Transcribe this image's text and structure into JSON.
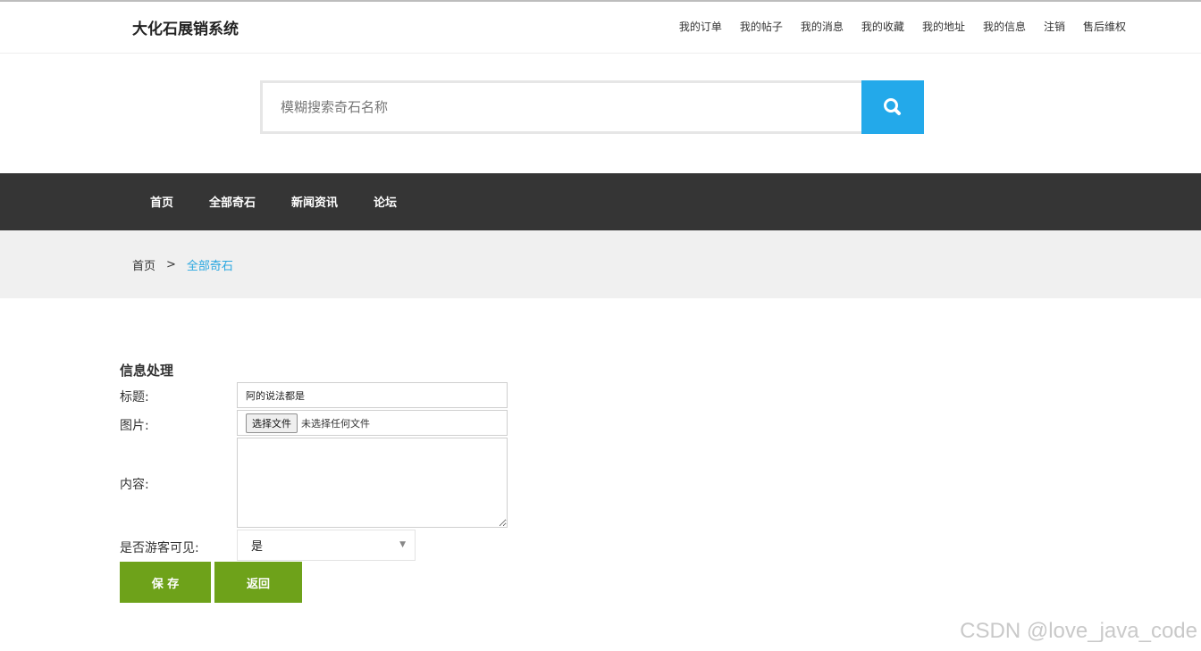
{
  "header": {
    "site_title": "大化石展销系统",
    "top_nav": [
      "我的订单",
      "我的帖子",
      "我的消息",
      "我的收藏",
      "我的地址",
      "我的信息",
      "注销",
      "售后维权"
    ]
  },
  "search": {
    "placeholder": "模糊搜索奇石名称",
    "button_icon": "search-icon",
    "accent_color": "#23a9ea"
  },
  "main_nav": {
    "items": [
      "首页",
      "全部奇石",
      "新闻资讯",
      "论坛"
    ]
  },
  "breadcrumb": {
    "home": "首页",
    "separator": ">",
    "current": "全部奇石"
  },
  "form": {
    "title": "信息处理",
    "title_label": "标题:",
    "title_value": "阿的说法都是",
    "image_label": "图片:",
    "file_button": "选择文件",
    "file_status": "未选择任何文件",
    "content_label": "内容:",
    "content_value": "",
    "visible_label": "是否游客可见:",
    "visible_value": "是",
    "save_label": "保 存",
    "back_label": "返回",
    "button_color": "#6ea21a"
  },
  "watermark": "CSDN @love_java_code"
}
